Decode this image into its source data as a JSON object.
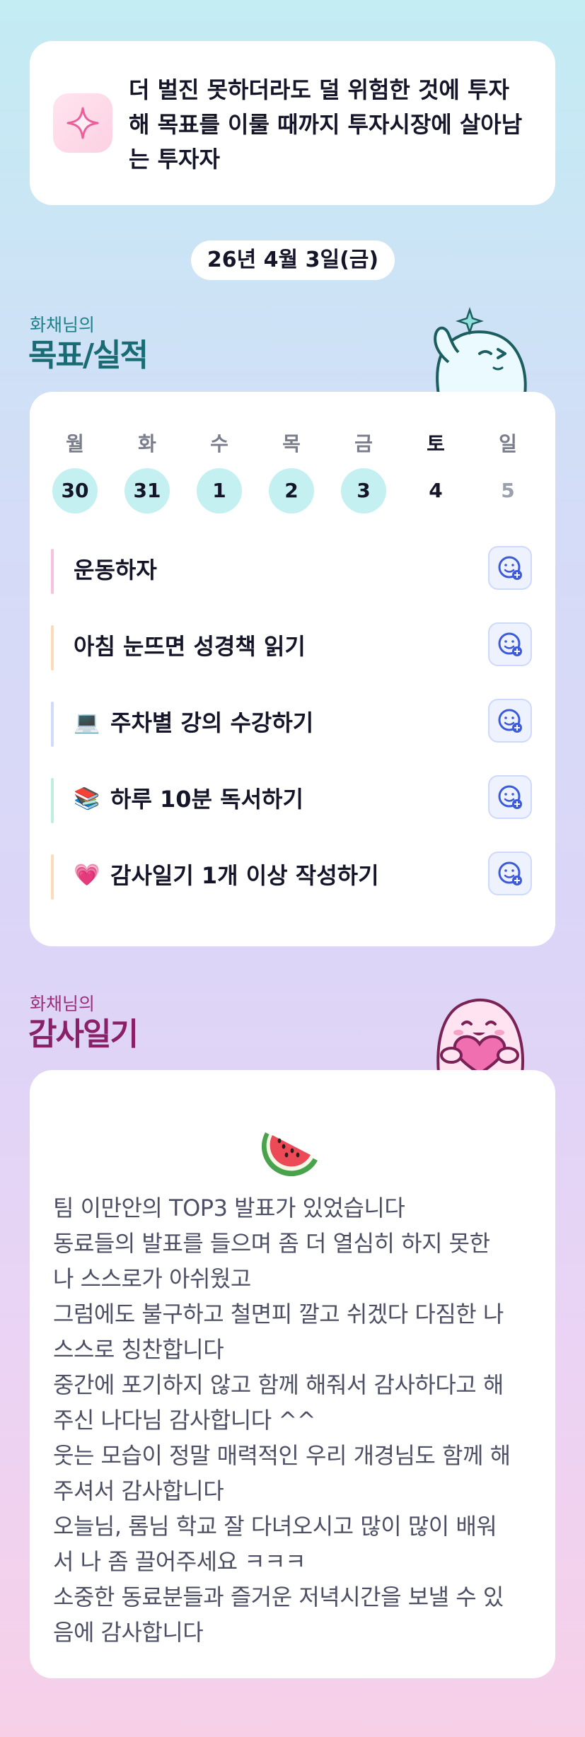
{
  "motto": {
    "icon": "sparkle-icon",
    "lines": [
      "더 벌진 못하더라도 덜 위험한 것에 투자",
      "해 목표를 이룰 때까지 투자시장에 살아남",
      "는 투자자"
    ]
  },
  "date": "26년 4월 3일(금)",
  "goals_section": {
    "subtitle": "화채님의",
    "title": "목표/실적"
  },
  "week": {
    "days": [
      {
        "label": "월",
        "num": "30",
        "state": "done"
      },
      {
        "label": "화",
        "num": "31",
        "state": "done"
      },
      {
        "label": "수",
        "num": "1",
        "state": "done"
      },
      {
        "label": "목",
        "num": "2",
        "state": "done"
      },
      {
        "label": "금",
        "num": "3",
        "state": "done"
      },
      {
        "label": "토",
        "num": "4",
        "state": "today"
      },
      {
        "label": "일",
        "num": "5",
        "state": "future"
      }
    ]
  },
  "goals": [
    {
      "emoji": "",
      "text": "운동하자",
      "color": "#f7c2de"
    },
    {
      "emoji": "",
      "text": "아침 눈뜨면 성경책 읽기",
      "color": "#fcdcb8"
    },
    {
      "emoji": "💻",
      "text": "주차별 강의 수강하기",
      "color": "#d2dbf7"
    },
    {
      "emoji": "📚",
      "text": "하루 10분 독서하기",
      "color": "#bfeedd"
    },
    {
      "emoji": "💗",
      "text": "감사일기 1개 이상 작성하기",
      "color": "#fcdcb8"
    }
  ],
  "gratitude_section": {
    "subtitle": "화채님의",
    "title": "감사일기"
  },
  "gratitude": {
    "icon": "watermelon-icon",
    "lines": [
      "팀 이만안의 TOP3 발표가 있었습니다",
      "동료들의 발표를 들으며 좀 더 열심히 하지 못한",
      "나 스스로가 아쉬웠고",
      "그럼에도 불구하고 철면피 깔고 쉬겠다 다짐한 나",
      "스스로 칭찬합니다",
      "중간에 포기하지 않고 함께 해줘서 감사하다고 해",
      "주신 나다님 감사합니다 ^^",
      "웃는 모습이 정말 매력적인 우리 개경님도 함께 해",
      "주셔서 감사합니다",
      "오늘님, 롬님 학교 잘 다녀오시고 많이 많이 배워",
      "서 나 좀 끌어주세요 ㅋㅋㅋ",
      "소중한 동료분들과 즐거운 저녁시간을 보낼 수 있",
      "음에 감사합니다"
    ]
  }
}
